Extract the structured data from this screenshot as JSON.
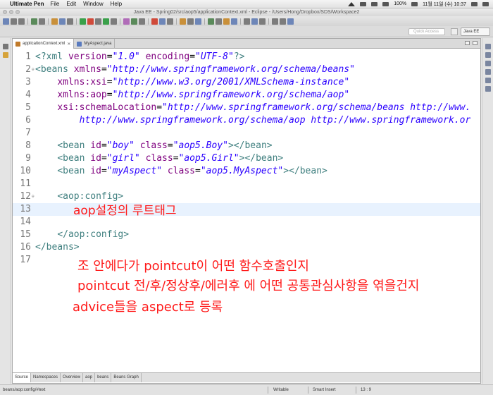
{
  "menubar": {
    "app_name": "Ultimate Pen",
    "items": [
      "File",
      "Edit",
      "Window",
      "Help"
    ],
    "battery": "100%",
    "clock": "11월 11일 (수)  10:37"
  },
  "window": {
    "title": "Java EE - Spring02/src/aop5/applicationContext.xml - Eclipse - /Users/Hong/Dropbox/SDS/Workspace2"
  },
  "perspective": {
    "quick_access_placeholder": "Quick Access",
    "current": "Java EE"
  },
  "editor": {
    "tabs": [
      {
        "label": "applicationContext.xml",
        "active": true
      },
      {
        "label": "MyAspect.java",
        "active": false
      }
    ],
    "bottom_tabs": [
      "Source",
      "Namespaces",
      "Overview",
      "aop",
      "beans",
      "Beans Graph"
    ],
    "active_bottom_tab": "Source",
    "lines": [
      {
        "n": "1",
        "fold": ""
      },
      {
        "n": "2",
        "fold": "⊖"
      },
      {
        "n": "3",
        "fold": ""
      },
      {
        "n": "4",
        "fold": ""
      },
      {
        "n": "5",
        "fold": ""
      },
      {
        "n": "6",
        "fold": ""
      },
      {
        "n": "7",
        "fold": ""
      },
      {
        "n": "8",
        "fold": ""
      },
      {
        "n": "9",
        "fold": ""
      },
      {
        "n": "10",
        "fold": ""
      },
      {
        "n": "11",
        "fold": ""
      },
      {
        "n": "12",
        "fold": "⊖"
      },
      {
        "n": "13",
        "fold": ""
      },
      {
        "n": "14",
        "fold": ""
      },
      {
        "n": "15",
        "fold": ""
      },
      {
        "n": "16",
        "fold": ""
      },
      {
        "n": "17",
        "fold": ""
      }
    ],
    "code": {
      "l1": {
        "a": "<?xml ",
        "b": "version",
        "c": "=",
        "d": "\"1.0\"",
        "e": " ",
        "f": "encoding",
        "g": "=",
        "h": "\"UTF-8\"",
        "i": "?>"
      },
      "l2": {
        "a": "<beans ",
        "b": "xmlns",
        "c": "=",
        "d": "\"http://www.springframework.org/schema/beans\""
      },
      "l3": {
        "b": "xmlns:xsi",
        "c": "=",
        "d": "\"http://www.w3.org/2001/XMLSchema-instance\""
      },
      "l4": {
        "b": "xmlns:aop",
        "c": "=",
        "d": "\"http://www.springframework.org/schema/aop\""
      },
      "l5": {
        "b": "xsi:schemaLocation",
        "c": "=",
        "d": "\"http://www.springframework.org/schema/beans http://www."
      },
      "l6": {
        "d": "http://www.springframework.org/schema/aop http://www.springframework.or"
      },
      "l8": {
        "a": "<bean ",
        "b": "id",
        "c": "=",
        "d": "\"boy\"",
        "e": " ",
        "f": "class",
        "g": "=",
        "h": "\"aop5.Boy\"",
        "i": "></bean>"
      },
      "l9": {
        "a": "<bean ",
        "b": "id",
        "c": "=",
        "d": "\"girl\"",
        "e": " ",
        "f": "class",
        "g": "=",
        "h": "\"aop5.Girl\"",
        "i": "></bean>"
      },
      "l10": {
        "a": "<bean ",
        "b": "id",
        "c": "=",
        "d": "\"myAspect\"",
        "e": " ",
        "f": "class",
        "g": "=",
        "h": "\"aop5.MyAspect\"",
        "i": "></bean>"
      },
      "l12": {
        "a": "<aop:config>"
      },
      "l15": {
        "a": "</aop:config>"
      },
      "l16": {
        "a": "</beans>"
      }
    },
    "annotations": {
      "line13": "aop설정의 루트태그",
      "note1": "조 안에다가 pointcut이 어떤 함수호출인지",
      "note2": "pointcut 전/후/정상후/에러후 에 어떤 공통관심사항을 엮을건지",
      "note3": "advice들을 aspect로 등록"
    }
  },
  "status": {
    "path": "beans/aop:config/#text",
    "mode": "Writable",
    "insert": "Smart Insert",
    "position": "13 : 9"
  },
  "colors": {
    "tag": "#3f7f7f",
    "attribute": "#7f007f",
    "value": "#2a00ff",
    "annotation": "#ff1a1a",
    "current_line": "#e8f2fe"
  }
}
